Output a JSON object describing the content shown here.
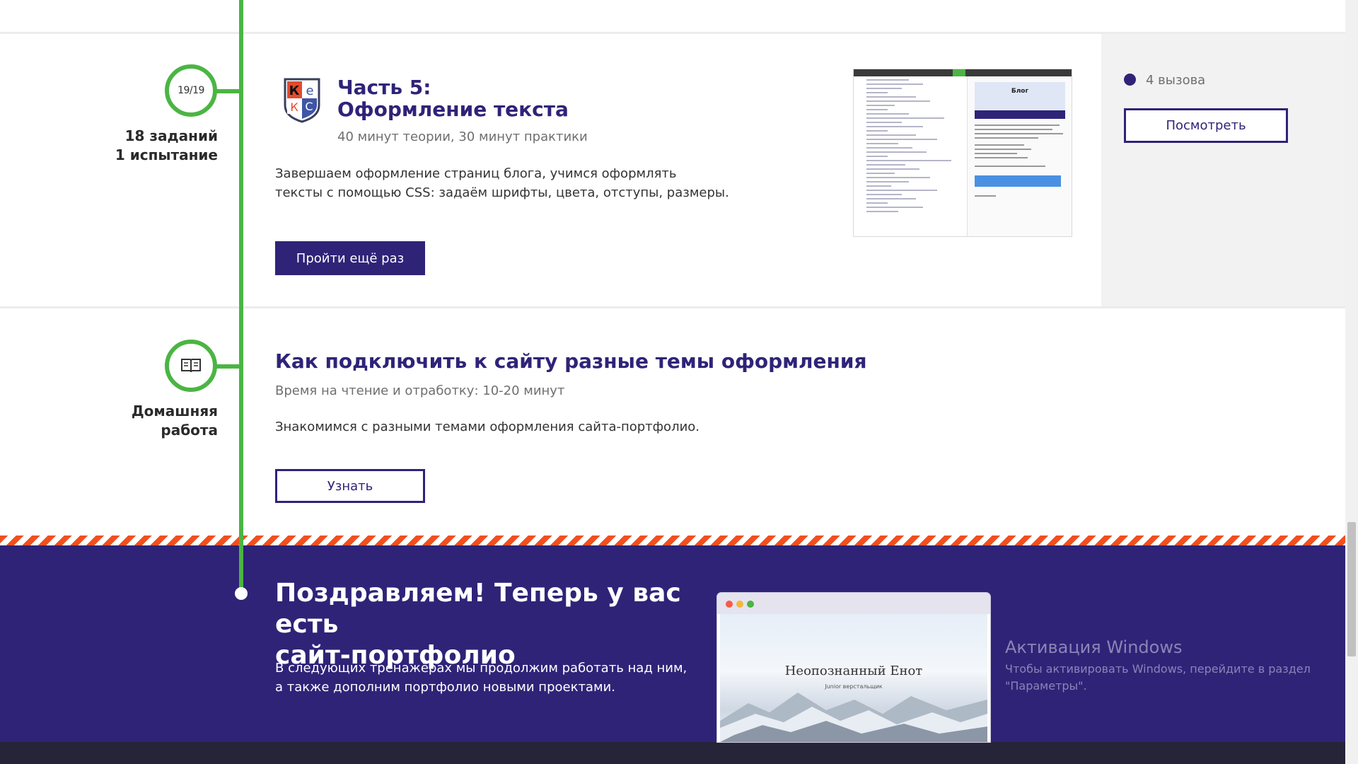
{
  "part5": {
    "counter": "19/19",
    "side_label_1": "18 заданий",
    "side_label_2": "1 испытание",
    "logo_letters": [
      "К",
      "е",
      "К",
      "С"
    ],
    "title_line1": "Часть 5:",
    "title_line2": "Оформление текста",
    "meta": "40 минут теории, 30 минут практики",
    "desc_line1": "Завершаем оформление страниц блога, учимся оформлять",
    "desc_line2": "тексты с помощью CSS: задаём шрифты, цвета, отступы, размеры.",
    "retry_button": "Пройти ещё раз",
    "preview_heading": "Блог",
    "challenges": "4 вызова",
    "view_button": "Посмотреть"
  },
  "homework": {
    "side_label_1": "Домашняя",
    "side_label_2": "работа",
    "title": "Как подключить к сайту разные темы оформления",
    "meta": "Время на чтение и отработку: 10-20 минут",
    "desc": "Знакомимся с разными темами оформления сайта-портфолио.",
    "learn_button": "Узнать"
  },
  "congrats": {
    "title_line1": "Поздравляем! Теперь у вас есть",
    "title_line2": "сайт-портфолио",
    "desc_line1": "В следующих тренажёрах мы продолжим работать над ним,",
    "desc_line2": "а также дополним портфолио новыми проектами.",
    "site_name": "Неопознанный Енот",
    "site_sub": "Junior верстальщик"
  },
  "windows": {
    "title": "Активация Windows",
    "desc_line1": "Чтобы активировать Windows, перейдите в раздел",
    "desc_line2": "\"Параметры\"."
  },
  "colors": {
    "accent": "#2f2378",
    "timeline": "#4bb543",
    "stripe": "#f0501e"
  }
}
